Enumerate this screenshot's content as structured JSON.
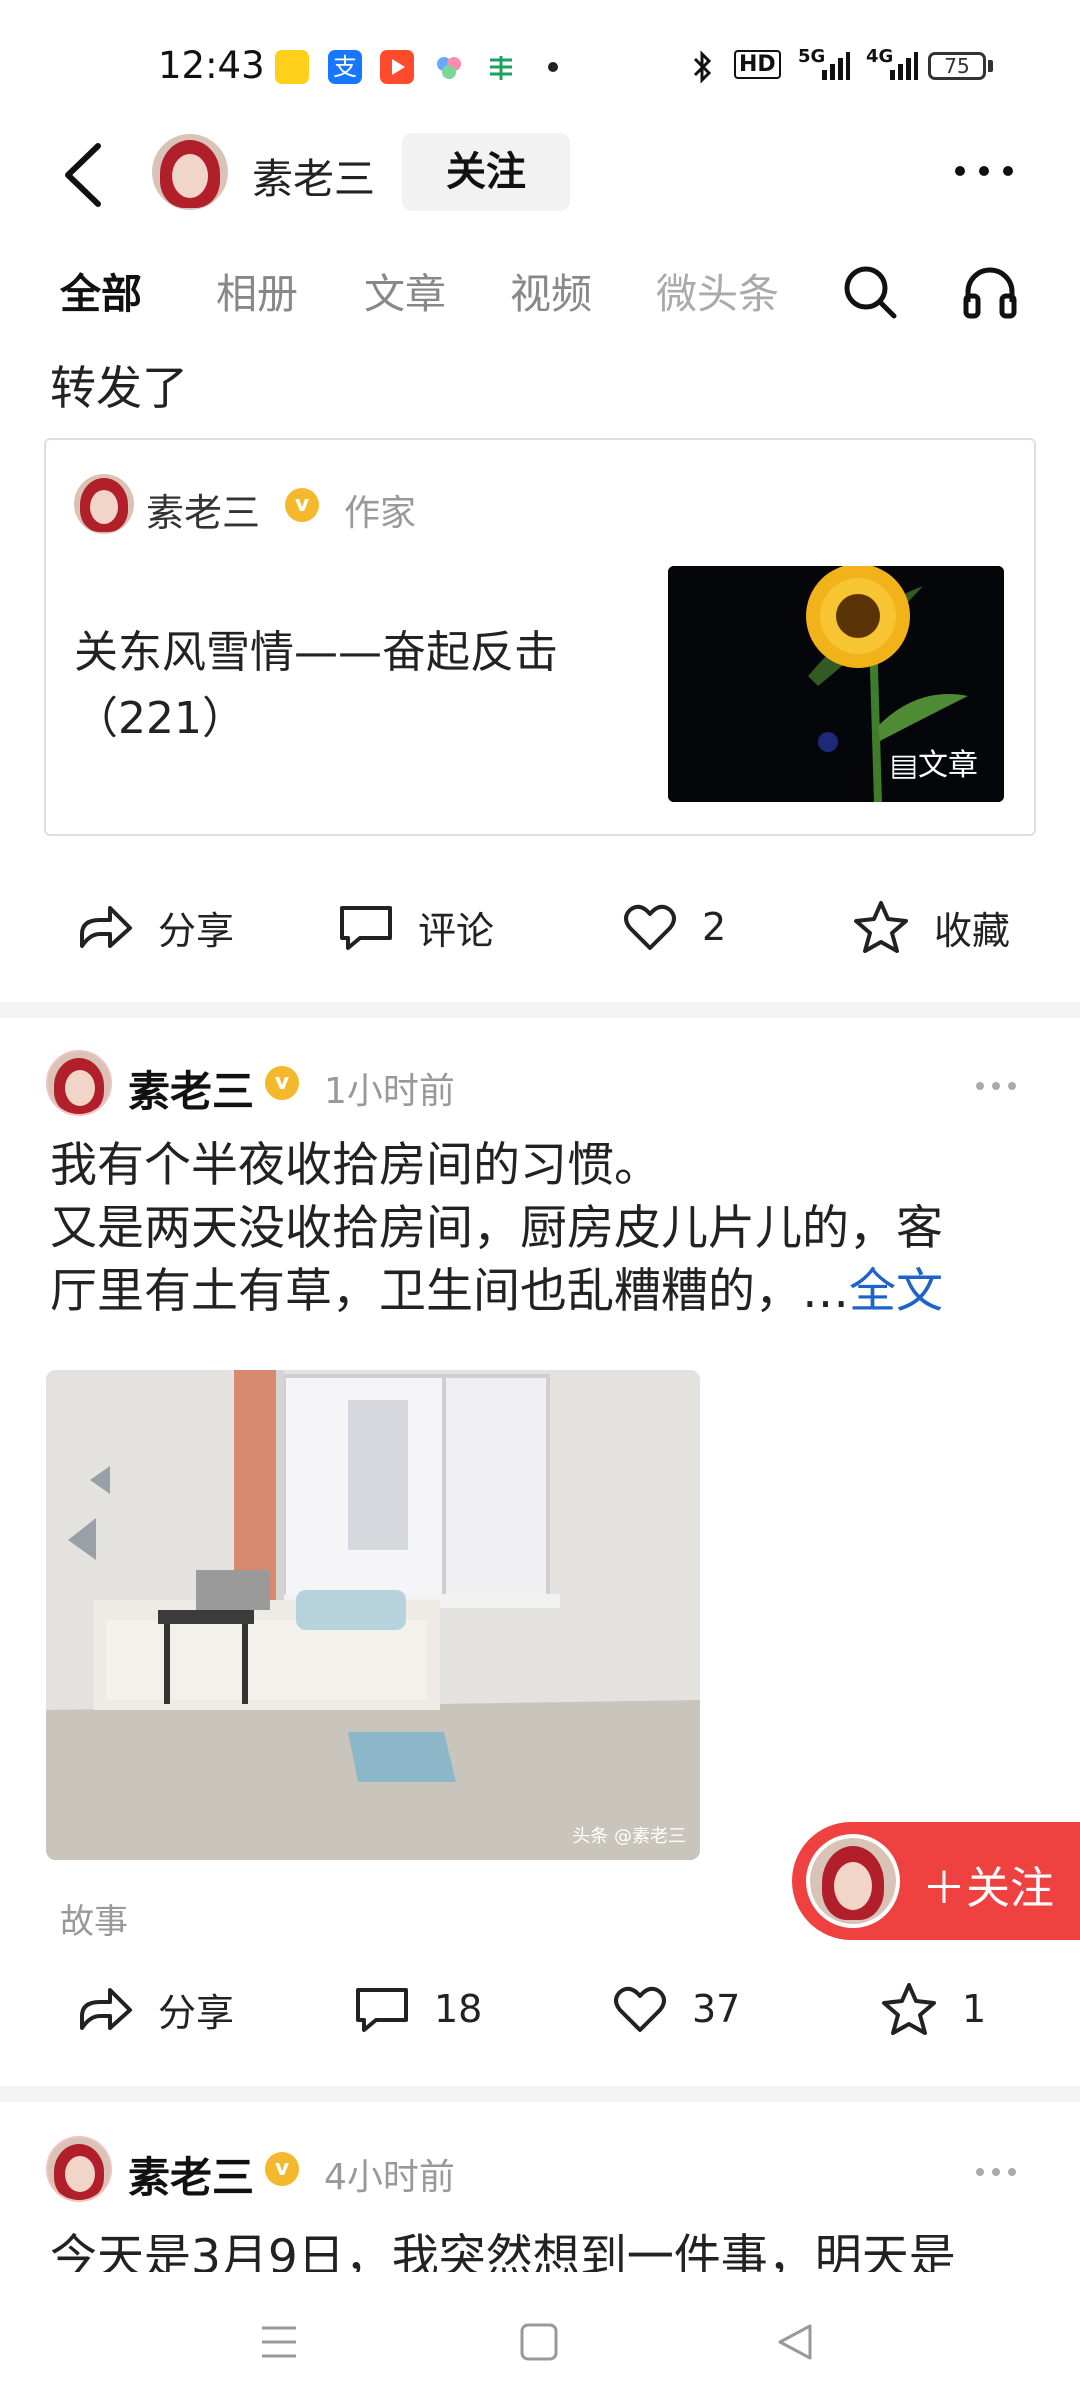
{
  "status_bar": {
    "time": "12:43",
    "battery": "75",
    "network_1": "5G",
    "network_2": "4G",
    "hd": "HD"
  },
  "header": {
    "nickname": "素老三",
    "follow_label": "关注",
    "more": "···"
  },
  "tabs": [
    "全部",
    "相册",
    "文章",
    "视频",
    "微头条"
  ],
  "repost": {
    "label": "转发了",
    "card": {
      "author": "素老三",
      "role": "作家",
      "title": "关东风雪情——奋起反击（221）",
      "thumb_tag": "文章"
    },
    "actions": {
      "share": "分享",
      "comment": "评论",
      "like": "2",
      "favorite": "收藏"
    }
  },
  "post2": {
    "author": "素老三",
    "time": "1小时前",
    "text_line1": "我有个半夜收拾房间的习惯。",
    "text_line2": "又是两天没收拾房间，厨房皮儿片儿的，客",
    "text_line3": "厅里有土有草，卫生间也乱糟糟的，…",
    "fulltext": "全文",
    "watermark": "头条 @素老三",
    "tag": "故事",
    "actions": {
      "share": "分享",
      "comment": "18",
      "like": "37",
      "favorite": "1"
    }
  },
  "float_follow": {
    "label": "＋关注"
  },
  "post3": {
    "author": "素老三",
    "time": "4小时前",
    "text": "今天是3月9日，我突然想到一件事，明天是"
  },
  "colors": {
    "accent_blue": "#1e63c7",
    "follow_red": "#f04141",
    "verified_gold": "#f3b82b"
  }
}
